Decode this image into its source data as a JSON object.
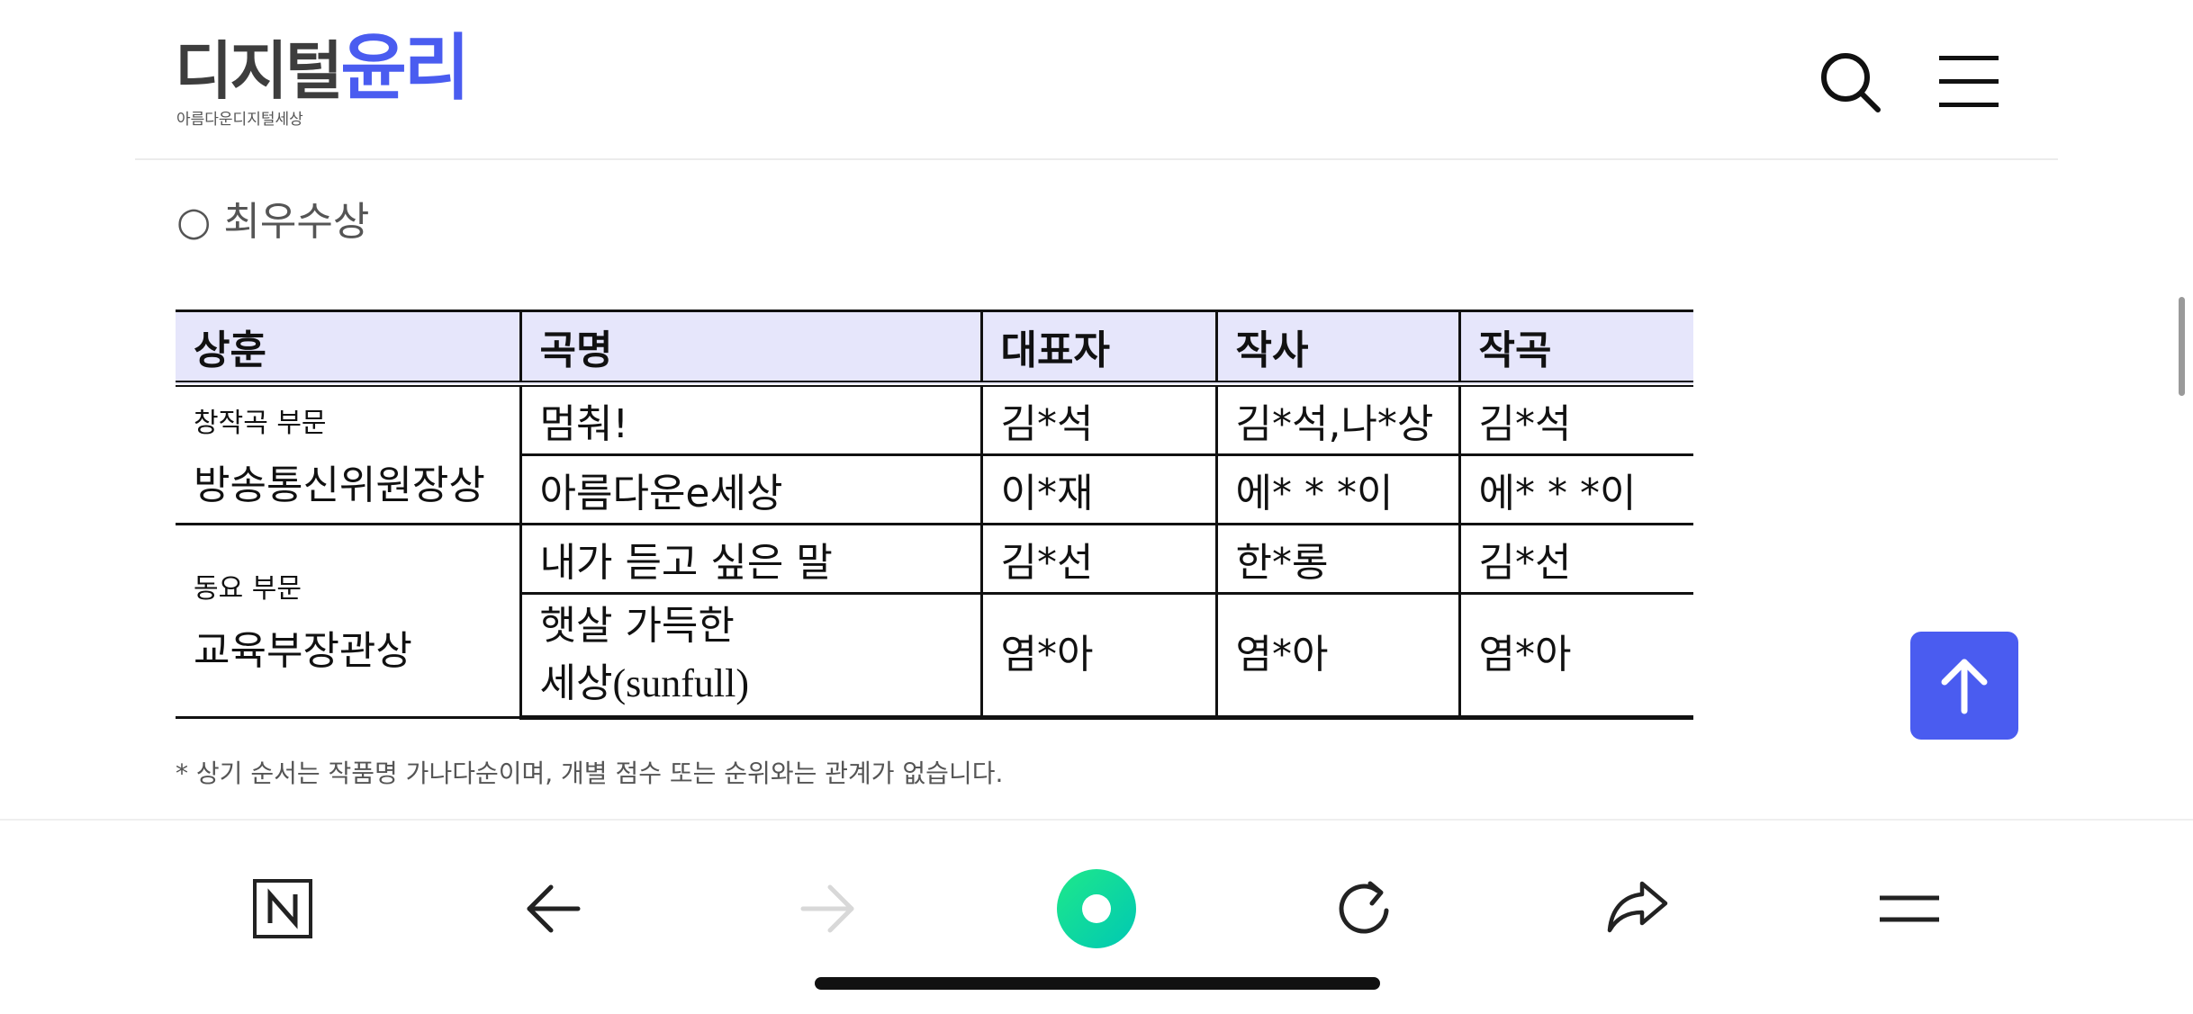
{
  "header": {
    "logo_main_dark": "디지털",
    "logo_main_accent": "윤리",
    "logo_sub": "아름다운디지털세상",
    "accent_color": "#4a5cf0",
    "icons": [
      "search-icon",
      "hamburger-menu-icon"
    ]
  },
  "section_title": "○ 최우수상",
  "table": {
    "headers": [
      "상훈",
      "곡명",
      "대표자",
      "작사",
      "작곡"
    ],
    "groups": [
      {
        "category": "창작곡 부문",
        "award": "방송통신위원장상",
        "rows": [
          {
            "title": "멈춰!",
            "representative": "김*석",
            "lyrics": "김*석,나*상",
            "composer": "김*석"
          },
          {
            "title": "아름다운e세상",
            "representative": "이*재",
            "lyrics": "에* * *이",
            "composer": "에* * *이"
          }
        ]
      },
      {
        "category": "동요 부문",
        "award": "교육부장관상",
        "rows": [
          {
            "title": "내가 듣고 싶은 말",
            "representative": "김*선",
            "lyrics": "한*롱",
            "composer": "김*선"
          },
          {
            "title_line1": "햇살 가득한",
            "title_line2": "세상(sunfull)",
            "representative": "염*아",
            "lyrics": "염*아",
            "composer": "염*아"
          }
        ]
      }
    ],
    "header_bg": "#e6e6fb"
  },
  "note": "* 상기 순서는 작품명 가나다순이며, 개별 점수 또는 순위와는 관계가 없습니다.",
  "top_button": {
    "icon": "arrow-up-icon"
  },
  "bottom_bar": {
    "icons": [
      "naver-n-icon",
      "back-arrow-icon",
      "forward-arrow-icon",
      "green-dot-icon",
      "refresh-icon",
      "share-icon",
      "menu-icon"
    ],
    "green_color": "#03c75a"
  }
}
